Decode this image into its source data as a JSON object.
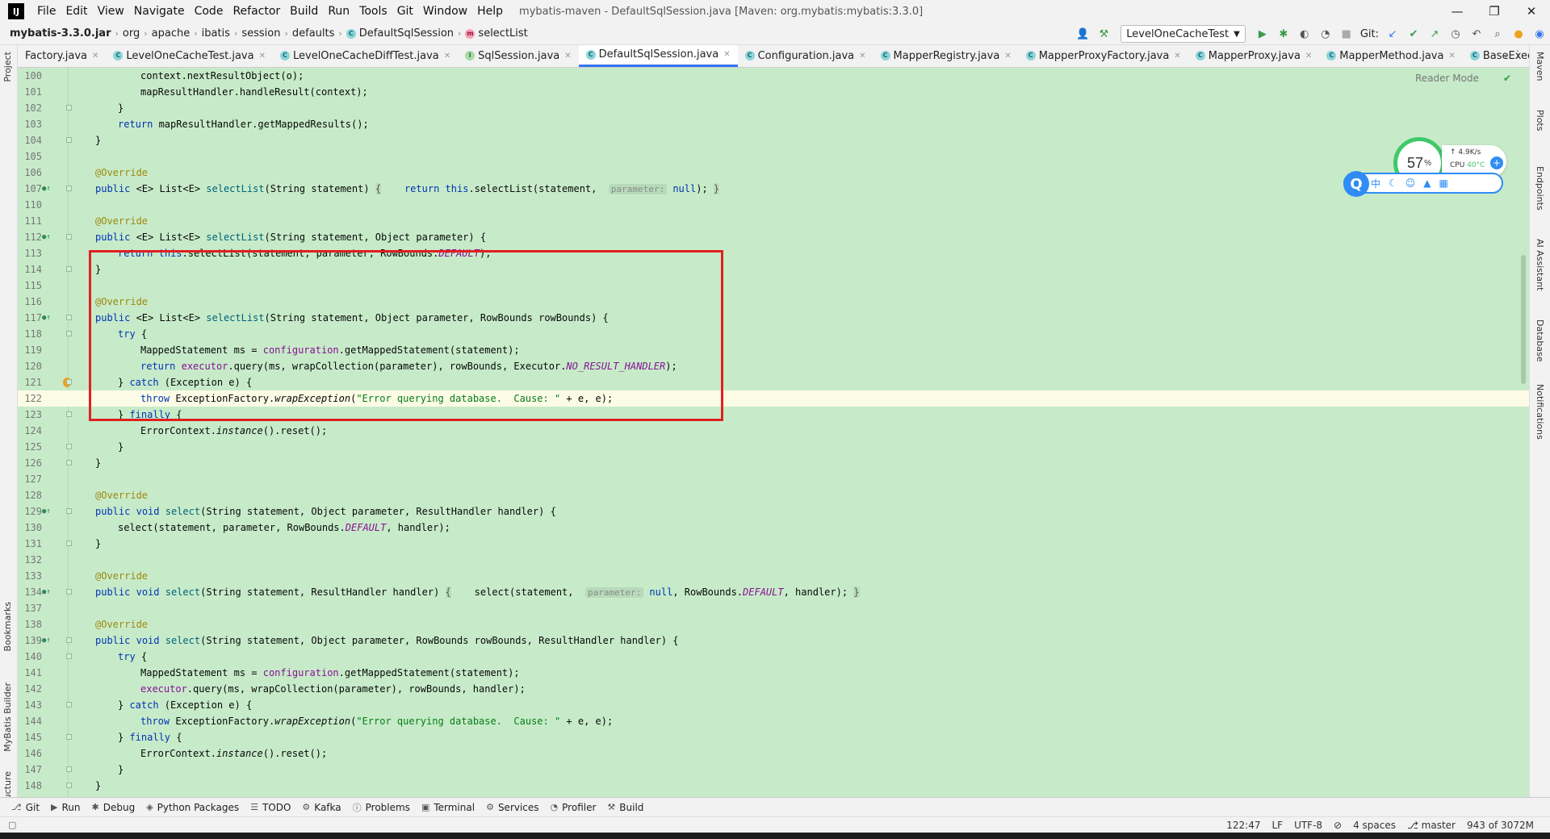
{
  "menubar": {
    "app_logo": "IJ",
    "items": [
      "File",
      "Edit",
      "View",
      "Navigate",
      "Code",
      "Refactor",
      "Build",
      "Run",
      "Tools",
      "Git",
      "Window",
      "Help"
    ],
    "window_title": "mybatis-maven - DefaultSqlSession.java [Maven: org.mybatis:mybatis:3.3.0]",
    "minimize": "—",
    "maximize": "❐",
    "close": "✕"
  },
  "navbar": {
    "breadcrumbs": [
      "mybatis-3.3.0.jar",
      "org",
      "apache",
      "ibatis",
      "session",
      "defaults",
      "DefaultSqlSession",
      "selectList"
    ],
    "run_config": "LevelOneCacheTest",
    "git_label": "Git:"
  },
  "tabs": [
    {
      "label": "Factory.java"
    },
    {
      "label": "LevelOneCacheTest.java"
    },
    {
      "label": "LevelOneCacheDiffTest.java"
    },
    {
      "label": "SqlSession.java"
    },
    {
      "label": "DefaultSqlSession.java"
    },
    {
      "label": "Configuration.java"
    },
    {
      "label": "MapperRegistry.java"
    },
    {
      "label": "MapperProxyFactory.java"
    },
    {
      "label": "MapperProxy.java"
    },
    {
      "label": "MapperMethod.java"
    },
    {
      "label": "BaseExecutor.java"
    }
  ],
  "left_strip": {
    "project": "Project",
    "bookmarks": "Bookmarks",
    "mybatis_builder": "MyBatis Builder",
    "structure": "Structure"
  },
  "right_strip": {
    "maven": "Maven",
    "plots": "Plots",
    "endpoints": "Endpoints",
    "ai_assistant": "AI Assistant",
    "database": "Database",
    "notifications": "Notifications"
  },
  "editor": {
    "reader_mode": "Reader Mode",
    "line_numbers": [
      "100",
      "101",
      "102",
      "103",
      "104",
      "105",
      "106",
      "107",
      "110",
      "111",
      "112",
      "113",
      "114",
      "115",
      "116",
      "117",
      "118",
      "119",
      "120",
      "121",
      "122",
      "123",
      "124",
      "125",
      "126",
      "127",
      "128",
      "129",
      "130",
      "131",
      "132",
      "133",
      "134",
      "137",
      "138",
      "139",
      "140",
      "141",
      "142",
      "143",
      "144",
      "145",
      "146",
      "147",
      "148"
    ],
    "code": {
      "l100": "context.nextResultObject(o);",
      "l101": "mapResultHandler.handleResult(context);",
      "l102": "}",
      "l103a": "return",
      "l103b": " mapResultHandler.getMappedResults();",
      "l104": "}",
      "ann": "@Override",
      "public": "public",
      "void": "void",
      "return": "return",
      "this": "this",
      "null": "null",
      "try": "try",
      "catch": "catch",
      "finally": "finally",
      "throw": "throw",
      "l107a": " <E> List<E> ",
      "l107b": "selectList",
      "l107c": "(String statement) ",
      "l107d": ".selectList(statement,  ",
      "l107e": ");",
      "hint_param": "parameter:",
      "l112c": "(String statement, Object parameter) {",
      "l113a": ".selectList(statement, parameter, RowBounds.",
      "default": "DEFAULT",
      "l113b": ");",
      "l117c": "(String statement, Object parameter, RowBounds rowBounds) {",
      "brace_open": "{",
      "brace_close": "}",
      "l119a": "MappedStatement ms = ",
      "configuration": "configuration",
      "l119b": ".getMappedStatement(statement);",
      "executor": "executor",
      "l120a": ".query(ms, wrapCollection(parameter), rowBounds, Executor.",
      "no_result": "NO_RESULT_HANDLER",
      "l120b": ");",
      "l121a": "} ",
      "l121b": " (Exception e) {",
      "l122a": " ExceptionFactory.",
      "wrap": "wrapException",
      "l122b": "(",
      "err_str": "\"Error querying database.  Cause: \"",
      "l122c": " + e, e);",
      "l123b": " {",
      "l124a": "ErrorContext.",
      "instance": "instance",
      "l124b": "().reset();",
      "select": "select",
      "l129c": "(String statement, Object parameter, ResultHandler handler) {",
      "l130a": "select(statement, parameter, RowBounds.",
      "l130b": ", handler);",
      "l134c": "(String statement, ResultHandler handler) ",
      "l134d": "select(statement,  ",
      "l134e": ", RowBounds.",
      "l134f": ", handler);",
      "l139c": "(String statement, Object parameter, RowBounds rowBounds, ResultHandler handler) {",
      "l142b": ".query(ms, wrapCollection(parameter), rowBounds, handler);"
    }
  },
  "widget": {
    "cpu_percent": "57",
    "percent_sign": "%",
    "net_speed": "↑ 4.9K/s",
    "cpu_label": "CPU",
    "cpu_temp": "40°C",
    "q_logo": "Q",
    "ime": "中"
  },
  "toolwindows": [
    "Git",
    "Run",
    "Debug",
    "Python Packages",
    "TODO",
    "Kafka",
    "Problems",
    "Terminal",
    "Services",
    "Profiler",
    "Build"
  ],
  "statusbar": {
    "position": "122:47",
    "line_sep": "LF",
    "encoding": "UTF-8",
    "indent": "4 spaces",
    "branch": "master",
    "memory": "943 of 3072M"
  }
}
